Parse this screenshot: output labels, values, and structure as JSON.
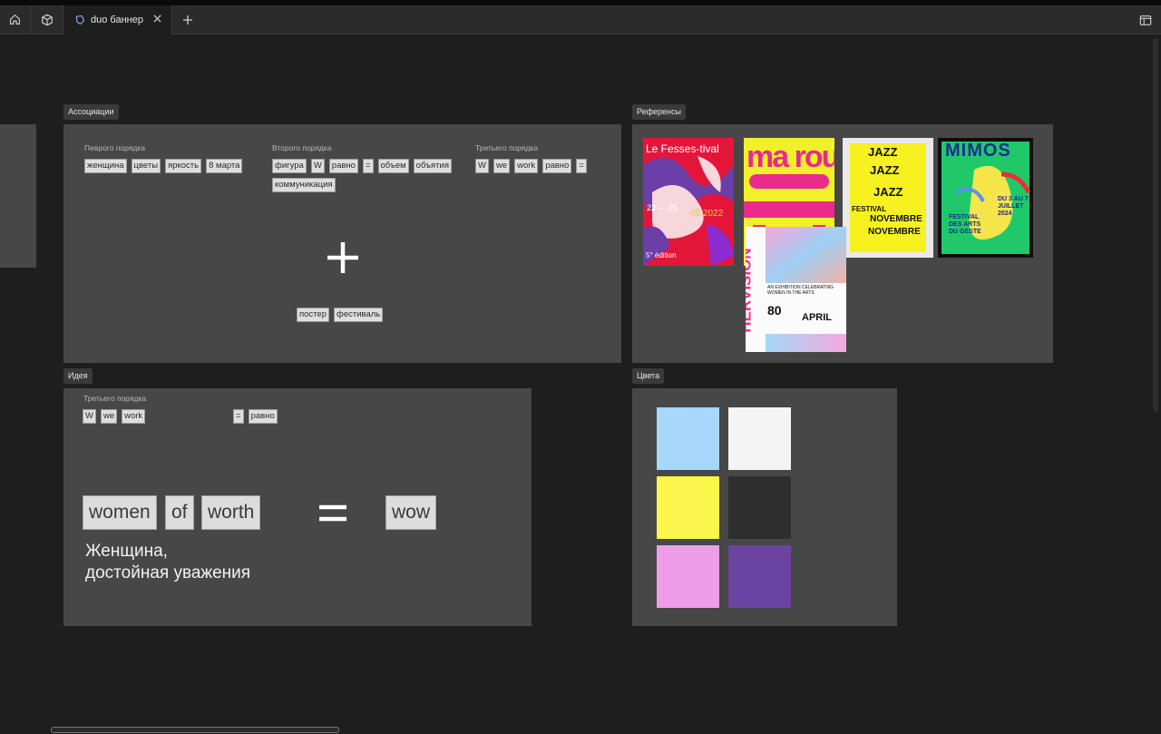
{
  "tab": {
    "title": "duo баннер"
  },
  "frames": {
    "associations": {
      "label": "Ассоциации",
      "col1": {
        "caption": "Певрого порядка",
        "chips": [
          "женщина",
          "цветы",
          "яркость",
          "8 марта"
        ]
      },
      "col2": {
        "caption": "Второго порядка",
        "chips": [
          "фигура",
          "W",
          "равно",
          "=",
          "объем",
          "объятия",
          "коммуникация"
        ]
      },
      "col3": {
        "caption": "Третьего порядка",
        "chips": [
          "W",
          "we",
          "work",
          "равно",
          "="
        ]
      },
      "bottom_chips": [
        "постер",
        "фестиваль"
      ]
    },
    "references": {
      "label": "Референсы",
      "posters": {
        "p1": {
          "title": "Le Fesses-tival",
          "dates": "22 — 25",
          "year": "09.2022",
          "edition": "5° édition"
        },
        "p2": {
          "text": "ma rou"
        },
        "p3": {
          "line1": "JAZZ",
          "line2": "NOVEMBRE",
          "line3": "FESTIVAL"
        },
        "p4": {
          "title": "MIMOS",
          "sub": "FESTIVAL DES ARTS DU GESTE",
          "date": "DU 3 AU 7 JUILLET 2024"
        },
        "p5": {
          "vertical": "HERVISION",
          "big": "80",
          "month": "APRIL",
          "desc": "AN EXHIBITION CELEBRATING WOMEN IN THE ARTS"
        }
      }
    },
    "idea": {
      "label": "Идея",
      "caption": "Третьего порядка",
      "chips_left": [
        "W",
        "we",
        "work"
      ],
      "chips_right": [
        "=",
        "равно"
      ],
      "big_words": [
        "women",
        "of",
        "worth"
      ],
      "result": "wow",
      "subtitle_line1": "Женщина,",
      "subtitle_line2": "достойная уважения"
    },
    "colors": {
      "label": "Цвета",
      "swatches": [
        "#a7d8fb",
        "#f4f4f4",
        "#fbf64b",
        "#2e2e2e",
        "#ee9ee8",
        "#6a44a0"
      ]
    }
  }
}
